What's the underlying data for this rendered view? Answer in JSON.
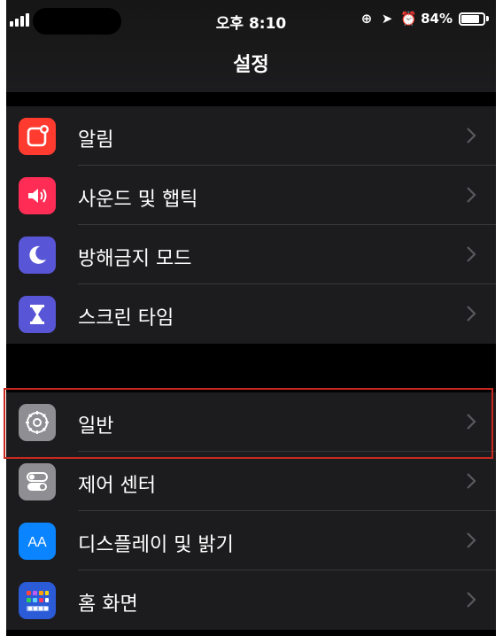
{
  "status_bar": {
    "time": "오후 8:10",
    "battery": "84%",
    "battery_level": 0.84
  },
  "nav": {
    "title": "설정"
  },
  "colors": {
    "background": "#000000",
    "cell": "#1c1c1e",
    "separator": "#38383a",
    "highlight": "#c9281f"
  },
  "group1": [
    {
      "label": "알림",
      "icon": "notifications-icon",
      "color": "#ff3b30"
    },
    {
      "label": "사운드 및 햅틱",
      "icon": "speaker-icon",
      "color": "#ff2d55"
    },
    {
      "label": "방해금지 모드",
      "icon": "moon-icon",
      "color": "#5856d6"
    },
    {
      "label": "스크린 타임",
      "icon": "hourglass-icon",
      "color": "#5856d6"
    }
  ],
  "group2": [
    {
      "label": "일반",
      "icon": "gear-icon",
      "color": "#8e8e93"
    },
    {
      "label": "제어 센터",
      "icon": "toggles-icon",
      "color": "#8e8e93"
    },
    {
      "label": "디스플레이 및 밝기",
      "icon": "display-aa-icon",
      "color": "#0a84ff"
    },
    {
      "label": "홈 화면",
      "icon": "home-grid-icon",
      "color": "#2c5bd8"
    }
  ]
}
